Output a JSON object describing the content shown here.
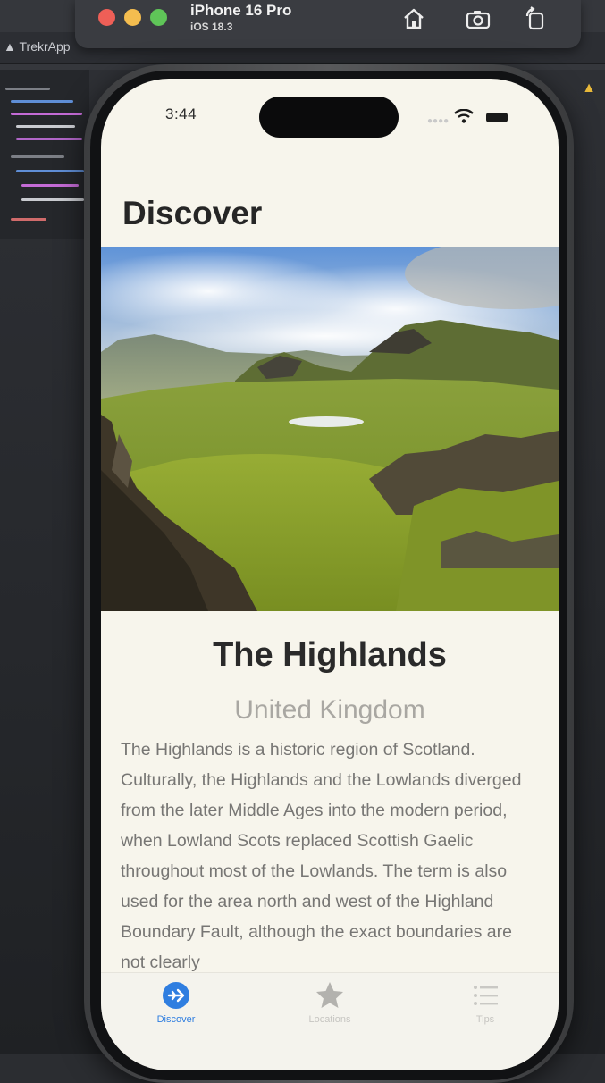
{
  "simulator": {
    "device_name": "iPhone 16 Pro",
    "os_version": "iOS 18.3",
    "traffic_colors": [
      "#ee5f57",
      "#f4bd4f",
      "#5fc558"
    ]
  },
  "xcode": {
    "project_tab": "TrekrApp"
  },
  "status_bar": {
    "time": "3:44"
  },
  "screen": {
    "nav_title": "Discover",
    "hero_image_icon": "highlands-landscape-photo"
  },
  "place": {
    "title": "The Highlands",
    "country": "United Kingdom",
    "description": "The Highlands is a historic region of Scotland. Culturally, the Highlands and the Lowlands diverged from the later Middle Ages into the modern period, when Lowland Scots replaced Scottish Gaelic throughout most of the Lowlands. The term is also used for the area north and west of the Highland Boundary Fault, although the exact boundaries are not clearly"
  },
  "tab_bar": {
    "accent": "#2f7ee0",
    "items": [
      {
        "label": "Discover",
        "icon": "airplane-circle-icon",
        "active": true
      },
      {
        "label": "Locations",
        "icon": "star-icon",
        "active": false
      },
      {
        "label": "Tips",
        "icon": "list-icon",
        "active": false
      }
    ]
  }
}
